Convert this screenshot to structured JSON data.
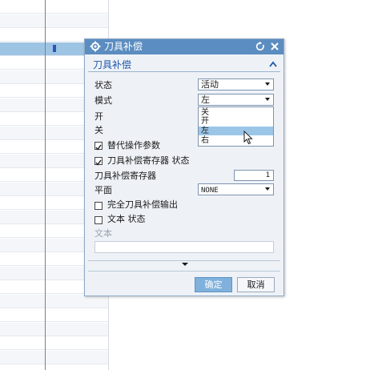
{
  "dialog": {
    "title": "刀具补偿",
    "icons": {
      "gear": "gear-icon",
      "reset": "reset-icon",
      "close": "close-icon"
    },
    "group_title": "刀具补偿",
    "fields": {
      "state_label": "状态",
      "state_value": "活动",
      "mode_label": "模式",
      "mode_value": "左",
      "mode_options": [
        "关",
        "开",
        "左",
        "右"
      ],
      "mode_highlighted": "左",
      "on_label": "开",
      "off_label": "关",
      "override_label": "替代操作参数",
      "override_checked": true,
      "register_state_label": "刀具补偿寄存器 状态",
      "register_state_checked": true,
      "register_label": "刀具补偿寄存器",
      "register_value": "1",
      "plane_label": "平面",
      "plane_value": "NONE",
      "full_output_label": "完全刀具补偿输出",
      "full_output_checked": false,
      "text_state_label": "文本 状态",
      "text_state_checked": false,
      "text_label": "文本",
      "text_value": ""
    },
    "buttons": {
      "ok": "确定",
      "cancel": "取消"
    }
  },
  "colors": {
    "title_bar": "#5b8dc1",
    "dialog_bg": "#eef2f7",
    "group_title": "#1d57a8",
    "selection": "#9cc6e8",
    "ok_button": "#7fb1dc"
  }
}
